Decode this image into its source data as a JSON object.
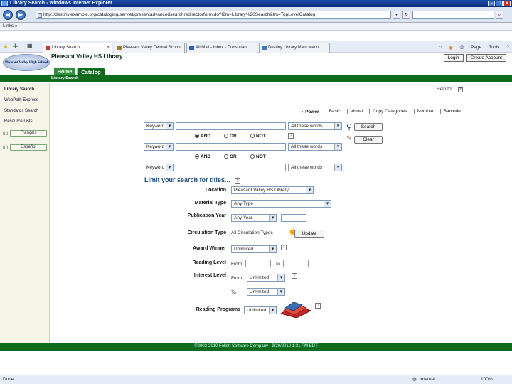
{
  "window": {
    "title": "Library Search - Windows Internet Explorer"
  },
  "address": {
    "url": "http://destiny.example.org/cataloging/servlet/presentadvancedsearchredirectorform.do?l2m=Library%20Search&tm=TopLevelCatalog",
    "search_value": ""
  },
  "links_bar": {
    "label": "Links"
  },
  "browser_tabs": [
    {
      "label": "Library Search"
    },
    {
      "label": "Pleasant Valley Central School..."
    },
    {
      "label": "All Mail - Inbox - Consultant"
    },
    {
      "label": "Destiny Library Main Menu"
    }
  ],
  "commands": {
    "page": "Page",
    "tools": "Tools"
  },
  "site": {
    "name": "Pleasant Valley HS Library",
    "login": "Login",
    "create_account": "Create Account",
    "logo_text": "Pleasant Valley High School"
  },
  "nav": {
    "home": "Home",
    "catalog": "Catalog",
    "sub": "Library Search"
  },
  "sidebar": {
    "items": [
      "Library Search",
      "WebPath Express",
      "Standards Search",
      "Resource Lists"
    ],
    "languages": [
      "Français",
      "Español"
    ]
  },
  "help": {
    "label": "Help for..."
  },
  "search_modes": [
    "Power",
    "Basic",
    "Visual",
    "Copy Categories",
    "Number",
    "Barcode"
  ],
  "search_rows": [
    {
      "field": "Keyword",
      "value": "",
      "scope": "All these words"
    },
    {
      "field": "Keyword",
      "value": "",
      "scope": "All these words"
    },
    {
      "field": "Keyword",
      "value": "",
      "scope": "All these words"
    }
  ],
  "boolean": {
    "and": "AND",
    "or": "OR",
    "not": "NOT"
  },
  "buttons": {
    "search": "Search",
    "clear": "Clear",
    "update": "Update"
  },
  "limits": {
    "heading": "Limit your search for titles...",
    "location_label": "Location",
    "location_value": "Pleasant Valley HS Library",
    "material_label": "Material Type",
    "material_value": "Any Type",
    "pubyear_label": "Publication Year",
    "pubyear_value": "Any Year",
    "circ_label": "Circulation Type",
    "circ_value": "All Circulation Types",
    "award_label": "Award Winner",
    "award_value": "Unlimited",
    "reading_label": "Reading Level",
    "from": "From",
    "to": "To",
    "interest_label": "Interest Level",
    "interest_from_value": "Unlimited",
    "interest_to_value": "Unlimited",
    "programs_label": "Reading Programs",
    "programs_value": "Unlimited"
  },
  "footer": {
    "text": "©2002-2010 Follett Software Company  ·  9/20/2010 1:31 PM EDT"
  },
  "status": {
    "left": "Done",
    "zone": "Internet",
    "zoom": "100%"
  },
  "colors": {
    "accent_green": "#0d6b1e",
    "ie_blue": "#1d4da8",
    "heading_blue": "#1c4f7a"
  }
}
